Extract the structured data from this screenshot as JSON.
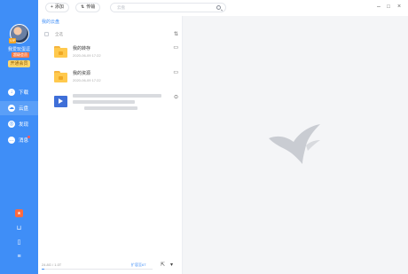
{
  "colors": {
    "accent": "#3f8ef7",
    "sidebar": "#3f8ef7",
    "folder": "#ffc94d",
    "preview_bg": "#f4f5f7"
  },
  "sidebar": {
    "vip_badge": "VIP",
    "user_name": "我爱玩蛋逗",
    "user_tag": "超级会员",
    "open_vip": "开通会员",
    "items": [
      {
        "label": "下载",
        "icon": "download-icon",
        "active": false
      },
      {
        "label": "云盘",
        "icon": "cloud-icon",
        "active": true
      },
      {
        "label": "发现",
        "icon": "discover-icon",
        "active": false
      },
      {
        "label": "消息",
        "icon": "message-icon",
        "active": false,
        "badge": true
      }
    ],
    "bottom_icons": [
      "gift-icon",
      "basket-icon",
      "phone-icon",
      "menu-icon"
    ]
  },
  "toolbar": {
    "add_label": "添加",
    "transfer_label": "传输",
    "search_placeholder": "云盘",
    "window_controls": [
      "minimize-icon",
      "maximize-icon",
      "close-icon"
    ]
  },
  "panel": {
    "breadcrumb": "我的云盘",
    "select_all": "全选",
    "files": [
      {
        "name": "我的转存",
        "date": "2020-06-09 17:22",
        "type": "folder"
      },
      {
        "name": "我的资源",
        "date": "2020-06-09 17:22",
        "type": "folder"
      },
      {
        "name": "",
        "date": "",
        "type": "video"
      }
    ],
    "storage": "24.8G / 1.0T",
    "expand": "扩容至6T",
    "storage_used_fraction": 0.024
  }
}
